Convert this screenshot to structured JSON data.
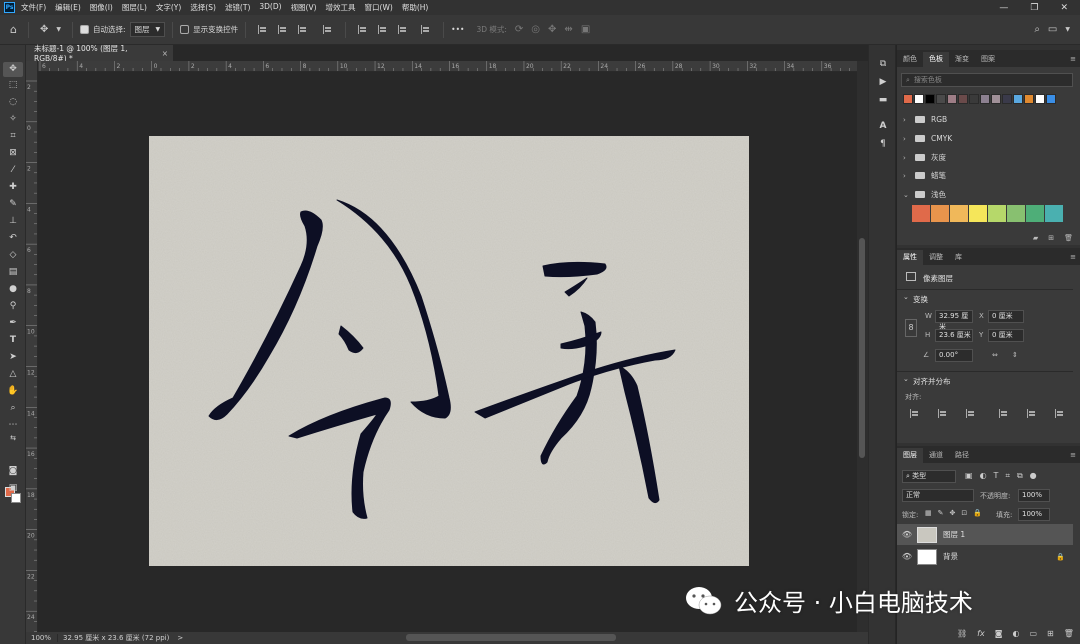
{
  "app": {
    "logo": "Ps",
    "menu": [
      "文件(F)",
      "编辑(E)",
      "图像(I)",
      "图层(L)",
      "文字(Y)",
      "选择(S)",
      "滤镜(T)",
      "3D(D)",
      "视图(V)",
      "增效工具",
      "窗口(W)",
      "帮助(H)"
    ]
  },
  "options_bar": {
    "auto_select_label": "自动选择:",
    "auto_select_value": "图层",
    "show_transform_label": "显示变换控件",
    "mode_3d_label": "3D 模式:",
    "more": "•••"
  },
  "document": {
    "tab_title": "未标题-1 @ 100% (图层 1, RGB/8#) *",
    "close": "×",
    "ruler_top_labels": [
      "6",
      "4",
      "2",
      "0",
      "2",
      "4",
      "6",
      "8",
      "10",
      "12",
      "14",
      "16",
      "18",
      "20",
      "22",
      "24",
      "26",
      "28",
      "30",
      "32",
      "34",
      "36"
    ],
    "ruler_left_labels": [
      "2",
      "0",
      "2",
      "4",
      "6",
      "8",
      "10",
      "12",
      "14",
      "16",
      "18",
      "20",
      "22",
      "24"
    ]
  },
  "status": {
    "zoom": "100%",
    "info": "32.95 厘米 x 23.6 厘米 (72 ppi)",
    "arrow": ">"
  },
  "swatches_panel": {
    "tabs": [
      "颜色",
      "色板",
      "渐变",
      "图案"
    ],
    "active_tab": "色板",
    "search_placeholder": "搜索色板",
    "recent": [
      "#e06a4a",
      "#ffffff",
      "#000000",
      "#4a4a4a",
      "#9e7d86",
      "#6a4a4a",
      "#3a3a3a",
      "#8c8090",
      "#a09098",
      "#3a3a4a",
      "#5aa8e0",
      "#e08a30",
      "#ffffff",
      "#3a8ee6"
    ],
    "groups": [
      "RGB",
      "CMYK",
      "灰度",
      "蜡笔",
      "浅色"
    ],
    "pastel": [
      "#e06a4a",
      "#e8944c",
      "#f0b85a",
      "#f5e65a",
      "#b6d86a",
      "#88c070",
      "#4eae78",
      "#4ab0b0"
    ]
  },
  "properties_panel": {
    "tabs": [
      "属性",
      "调整",
      "库"
    ],
    "active_tab": "属性",
    "layer_type": "像素图层",
    "transform_title": "变换",
    "w_label": "W",
    "w_value": "32.95 厘米",
    "x_label": "X",
    "x_value": "0 厘米",
    "h_label": "H",
    "h_value": "23.6 厘米",
    "y_label": "Y",
    "y_value": "0 厘米",
    "angle_value": "0.00°",
    "align_title": "对齐并分布",
    "align_label": "对齐:"
  },
  "layers_panel": {
    "tabs": [
      "图层",
      "通道",
      "路径"
    ],
    "active_tab": "图层",
    "filter_label": "类型",
    "blend_mode": "正常",
    "opacity_label": "不透明度:",
    "opacity_value": "100%",
    "lock_label": "锁定:",
    "fill_label": "填充:",
    "fill_value": "100%",
    "layers": [
      {
        "name": "图层 1",
        "selected": true
      },
      {
        "name": "背景",
        "locked": true
      }
    ]
  },
  "watermark": {
    "text": "公众号 · 小白电脑技术"
  }
}
